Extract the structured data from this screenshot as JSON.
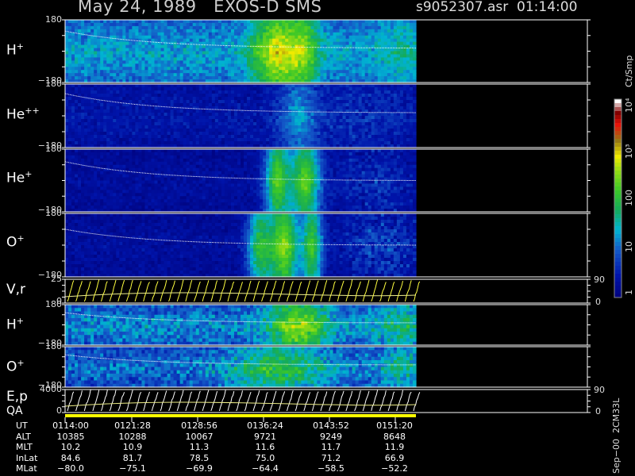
{
  "header": {
    "title": "May 24, 1989   EXOS-D SMS",
    "file": "s9052307.asr  01:14:00"
  },
  "chart_data": {
    "type": "heatmap",
    "title": "May 24, 1989   EXOS-D SMS",
    "colorbar": {
      "label": "Ct/Smp",
      "scale": "log",
      "range": [
        1,
        10000
      ],
      "ticks": [
        "1",
        "10",
        "100",
        "10³",
        "10⁴"
      ]
    },
    "panels": [
      {
        "label": "H+",
        "label_base": "H",
        "label_sup": "+",
        "ymin": "−180",
        "ymax": "180",
        "kind": "spectrogram"
      },
      {
        "label": "He++",
        "label_base": "He",
        "label_sup": "++",
        "ymin": "−180",
        "ymax": "180",
        "kind": "spectrogram"
      },
      {
        "label": "He+",
        "label_base": "He",
        "label_sup": "+",
        "ymin": "−180",
        "ymax": "180",
        "kind": "spectrogram"
      },
      {
        "label": "O+",
        "label_base": "O",
        "label_sup": "+",
        "ymin": "−180",
        "ymax": "180",
        "kind": "spectrogram"
      },
      {
        "label": "V,r",
        "label_base": "V,r",
        "label_sup": "",
        "ymin": "0",
        "ymax": "25",
        "rmin": "0",
        "rmax": "90",
        "kind": "line"
      },
      {
        "label": "H+",
        "label_base": "H",
        "label_sup": "+",
        "ymin": "−180",
        "ymax": "180",
        "kind": "spectrogram"
      },
      {
        "label": "O+",
        "label_base": "O",
        "label_sup": "+",
        "ymin": "−180",
        "ymax": "180",
        "kind": "spectrogram"
      },
      {
        "label": "E,p",
        "label_base": "E,p",
        "label_sup": "",
        "ymin": "0",
        "ymax": "4000",
        "rmin": "0",
        "rmax": "90",
        "kind": "line"
      }
    ],
    "qa_label": "QA",
    "x_rows": [
      {
        "name": "UT",
        "values": [
          "0114:00",
          "0121:28",
          "0128:56",
          "0136:24",
          "0143:52",
          "0151:20"
        ]
      },
      {
        "name": "ALT",
        "values": [
          "10385",
          "10288",
          "10067",
          "9721",
          "9249",
          "8648"
        ]
      },
      {
        "name": "MLT",
        "values": [
          "10.2",
          "10.9",
          "11.3",
          "11.6",
          "11.7",
          "11.9"
        ]
      },
      {
        "name": "InLat",
        "values": [
          "84.6",
          "81.7",
          "78.5",
          "75.0",
          "71.2",
          "66.9"
        ]
      },
      {
        "name": "MLat",
        "values": [
          "−80.0",
          "−75.1",
          "−69.9",
          "−64.4",
          "−58.5",
          "−52.2"
        ]
      }
    ],
    "footer": "Sep−00  2CM33L"
  },
  "colors": {
    "background": "#000000",
    "low": "#000088",
    "mid": "#22bb88",
    "high": "#ffee00",
    "peak": "#cc2200"
  }
}
